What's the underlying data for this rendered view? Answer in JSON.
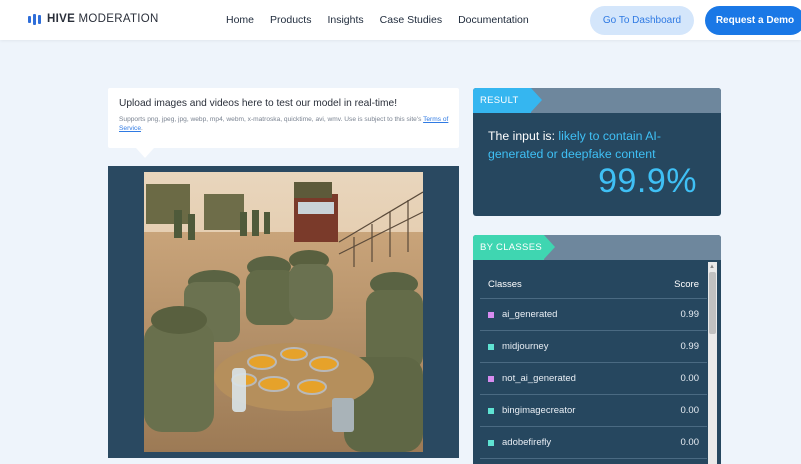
{
  "brand": {
    "name_bold": "HIVE",
    "name_rest": " MODERATION",
    "color": "#2f6ed9"
  },
  "nav": {
    "links": [
      "Home",
      "Products",
      "Insights",
      "Case Studies",
      "Documentation"
    ],
    "dashboard_button": "Go To Dashboard",
    "demo_button": "Request a Demo"
  },
  "upload": {
    "title": "Upload images and videos here to test our model in real-time!",
    "subtitle_prefix": "Supports png, jpeg, jpg, webp, mp4, webm, x-matroska, quicktime, avi, wmv. Use is subject to this site's ",
    "terms_link": "Terms of Service",
    "subtitle_suffix": "."
  },
  "image": {
    "icon": "uploaded-photo",
    "panel_color": "#2a4961"
  },
  "result": {
    "tag": "RESULT",
    "verdict_prefix": "The input is: ",
    "verdict_highlight": "likely to contain AI-generated or deepfake content",
    "percentage": "99.9%",
    "accent": "#3fc0f5"
  },
  "classes": {
    "tag": "BY CLASSES",
    "col_class": "Classes",
    "col_score": "Score",
    "rows": [
      {
        "label": "ai_generated",
        "score": "0.99",
        "color": "#d78cf0"
      },
      {
        "label": "midjourney",
        "score": "0.99",
        "color": "#5fe3d3"
      },
      {
        "label": "not_ai_generated",
        "score": "0.00",
        "color": "#d78cf0"
      },
      {
        "label": "bingimagecreator",
        "score": "0.00",
        "color": "#5fe3d3"
      },
      {
        "label": "adobefirefly",
        "score": "0.00",
        "color": "#5fe3d3"
      }
    ]
  }
}
